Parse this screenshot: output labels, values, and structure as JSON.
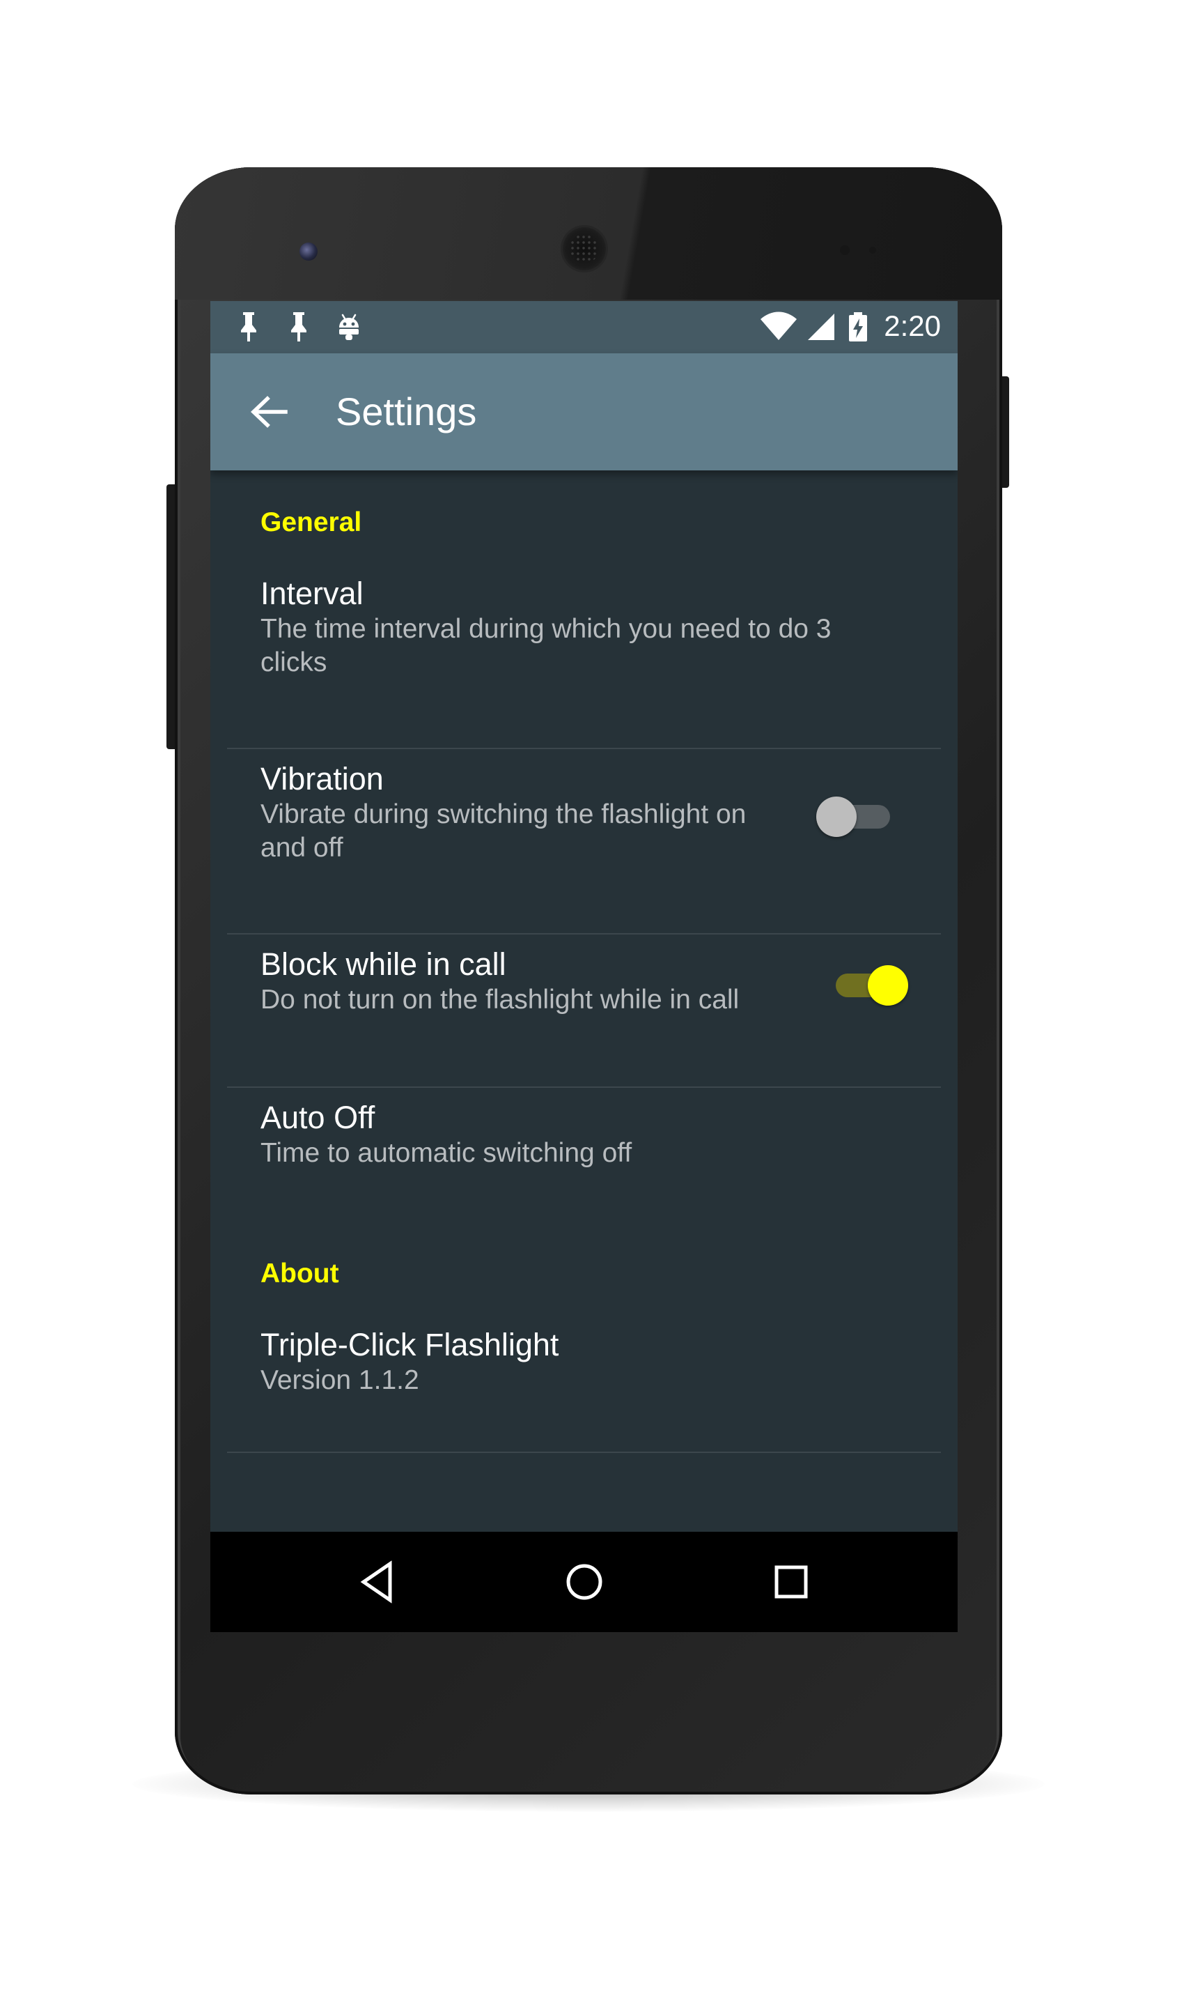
{
  "status_bar": {
    "time": "2:20",
    "left_icons": [
      "pin-icon",
      "pin-icon",
      "android-icon"
    ],
    "right_icons": [
      "wifi-icon",
      "signal-icon",
      "battery-charging-icon"
    ]
  },
  "app_bar": {
    "title": "Settings",
    "back_icon": "arrow-left-icon"
  },
  "sections": [
    {
      "header": "General",
      "items": [
        {
          "title": "Interval",
          "summary": "The time interval during which you need to do 3 clicks"
        },
        {
          "title": "Vibration",
          "summary": "Vibrate during switching the flashlight on and off",
          "toggle": false
        },
        {
          "title": "Block while in call",
          "summary": "Do not turn on the flashlight while in call",
          "toggle": true
        },
        {
          "title": "Auto Off",
          "summary": "Time to automatic switching off"
        }
      ]
    },
    {
      "header": "About",
      "items": [
        {
          "title": "Triple-Click Flashlight",
          "summary": "Version 1.1.2"
        }
      ]
    }
  ],
  "nav_bar": {
    "icons": [
      "back-triangle-icon",
      "home-circle-icon",
      "recents-square-icon"
    ]
  },
  "colors": {
    "status_bar": "#455a64",
    "app_bar": "#607d8b",
    "background": "#263238",
    "accent": "#ffff00"
  }
}
